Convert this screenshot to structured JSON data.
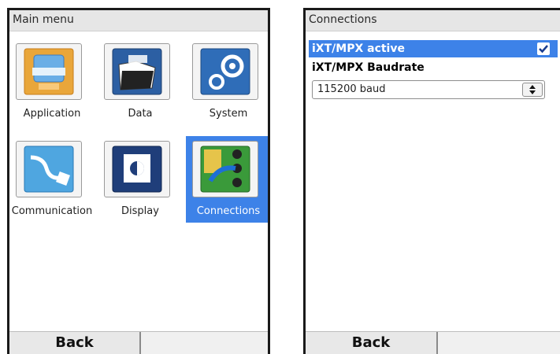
{
  "left_screen": {
    "title": "Main menu",
    "tiles": [
      {
        "label": "Application",
        "icon": "application-icon"
      },
      {
        "label": "Data",
        "icon": "data-folder-icon"
      },
      {
        "label": "System",
        "icon": "system-gear-icon"
      },
      {
        "label": "Communication",
        "icon": "communication-cable-icon"
      },
      {
        "label": "Display",
        "icon": "display-brightness-icon"
      },
      {
        "label": "Connections",
        "icon": "connections-icon",
        "selected": true
      }
    ],
    "softkeys": {
      "left": "Back",
      "right": ""
    }
  },
  "right_screen": {
    "title": "Connections",
    "items": [
      {
        "label": "iXT/MPX active",
        "checked": true,
        "selected": true
      },
      {
        "label": "iXT/MPX Baudrate"
      }
    ],
    "baudrate_select": {
      "value": "115200 baud"
    },
    "softkeys": {
      "left": "Back",
      "right": ""
    }
  },
  "colors": {
    "selection": "#3d82e8",
    "frame": "#1a1a1a",
    "bar": "#e8e8e8"
  }
}
